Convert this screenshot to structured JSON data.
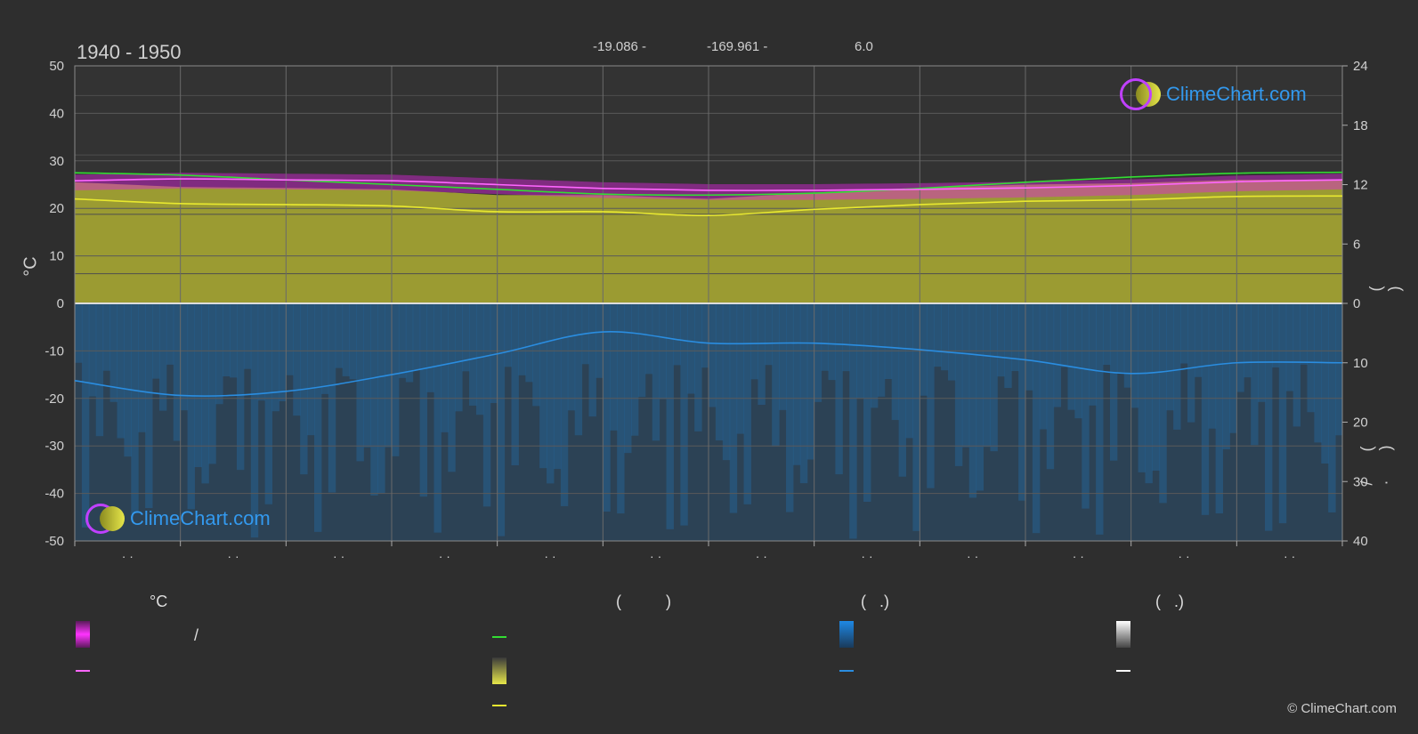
{
  "chart_data": {
    "type": "area",
    "title": "1940 - 1950",
    "header": {
      "lat": "-19.086 -",
      "lon": "-169.961 -",
      "elev": "6.0"
    },
    "y_left": {
      "label": "°C",
      "min": -50,
      "max": 50,
      "ticks": [
        50,
        40,
        30,
        20,
        10,
        0,
        -10,
        -20,
        -30,
        -40,
        -50
      ]
    },
    "y_right_top": {
      "min": 0,
      "max": 24,
      "ticks": [
        24,
        18,
        12,
        6,
        0
      ],
      "label": "(  )"
    },
    "y_right_bottom": {
      "min": 0,
      "max": 40,
      "ticks": [
        0,
        10,
        20,
        30,
        40
      ],
      "label": "/  ( · )"
    },
    "x_ticks": [
      "· ·",
      "· ·",
      "· ·",
      "· ·",
      "· ·",
      "· ·",
      "· ·",
      "· ·",
      "· ·",
      "· ·",
      "· ·",
      "· ·"
    ],
    "months_x": [
      0,
      1,
      2,
      3,
      4,
      5,
      6,
      7,
      8,
      9,
      10,
      11,
      12
    ],
    "series": [
      {
        "values": [
          27.5,
          27.0,
          26.0,
          25.0,
          24.0,
          23.0,
          22.8,
          23.2,
          24.2,
          25.5,
          26.6,
          27.4,
          27.6
        ],
        "color": "#33dd33"
      },
      {
        "values": [
          25.8,
          26.2,
          26.0,
          25.8,
          25.0,
          24.2,
          23.8,
          23.8,
          24.0,
          24.3,
          24.8,
          25.6,
          26.0
        ],
        "color": "#ff66ff"
      },
      {
        "values": [
          22.0,
          21.0,
          20.8,
          20.5,
          19.3,
          19.3,
          18.5,
          19.8,
          20.8,
          21.5,
          21.8,
          22.5,
          22.6
        ],
        "color": "#e8e830"
      },
      {
        "values": [
          13.0,
          15.5,
          14.8,
          12.0,
          8.5,
          4.8,
          6.7,
          6.7,
          7.8,
          9.5,
          11.8,
          10.0,
          10.0
        ],
        "color": "#2a8de0",
        "axis": "right_bottom"
      }
    ]
  },
  "legend": {
    "temp_header": "°C",
    "col2_header": "(          )",
    "col3_header": "(   .)",
    "col4_header": "(   .)",
    "slash": "/"
  },
  "watermark": "ClimeChart.com",
  "copyright": "© ClimeChart.com",
  "colors": {
    "bg": "#2e2e2e",
    "grid": "#5a5a5a",
    "sunshine": "#b8b832",
    "precip": "#1f5f95",
    "minmax": "#dd22dd"
  }
}
